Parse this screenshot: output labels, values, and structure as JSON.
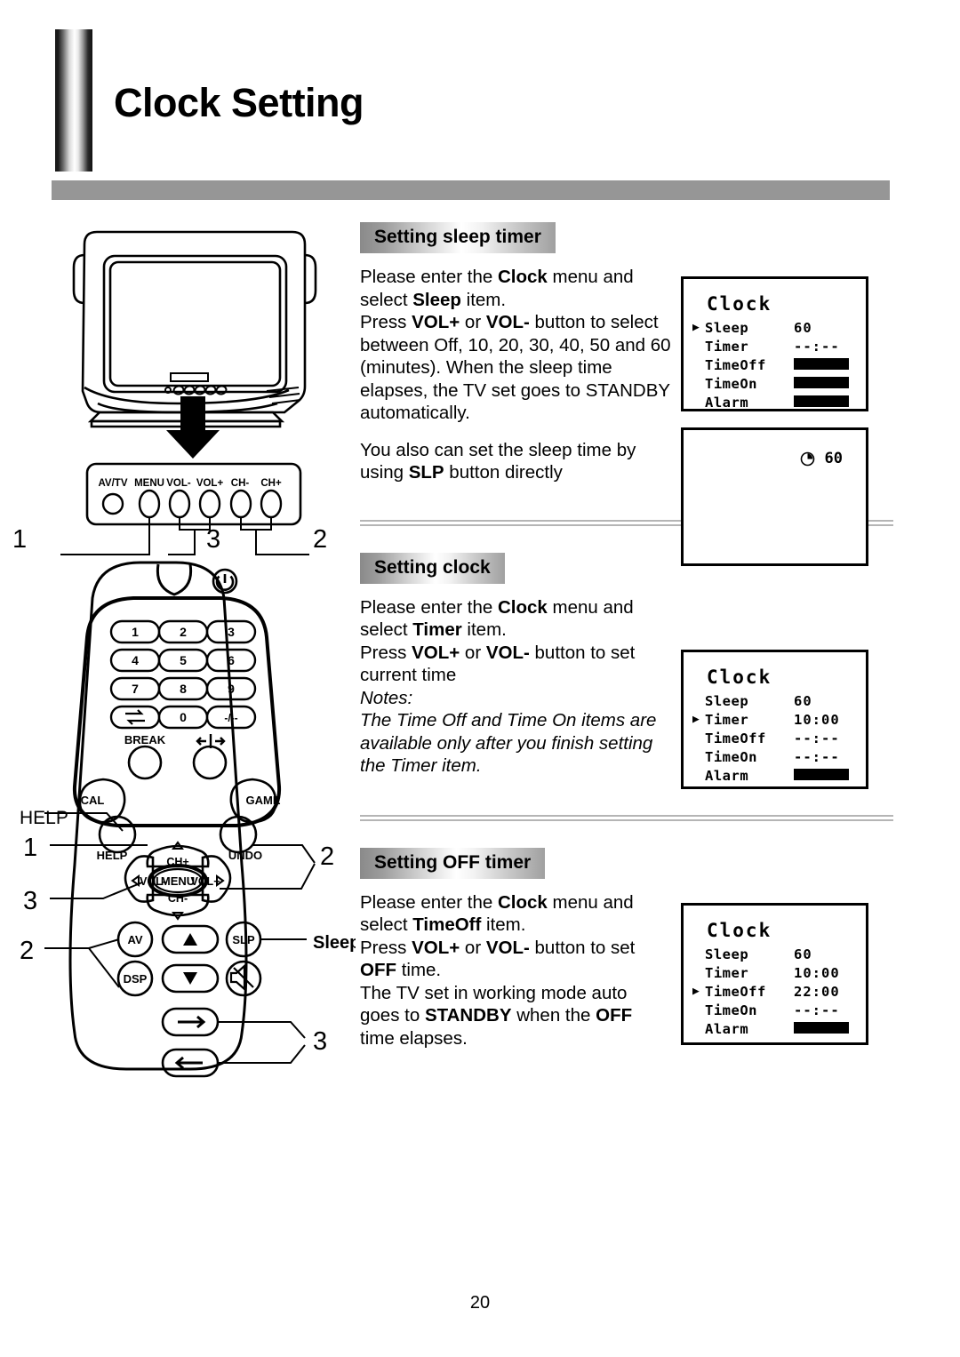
{
  "page": {
    "title": "Clock Setting",
    "number": "20"
  },
  "illustration": {
    "tv": {
      "panel_buttons": [
        "AV/TV",
        "MENU",
        "VOL-",
        "VOL+",
        "CH-",
        "CH+"
      ],
      "callouts": [
        "1",
        "3",
        "2"
      ]
    },
    "remote": {
      "keypad": [
        "1",
        "2",
        "3",
        "4",
        "5",
        "6",
        "7",
        "8",
        "9",
        "0"
      ],
      "swap_key": "swap-icon",
      "minus_key": "-/--",
      "break_label": "BREAK",
      "freeze_label": "freeze-icon",
      "cal_label": "CAL",
      "game_label": "GAME",
      "help_label": "HELP",
      "undo_label": "UNDO",
      "menu_label": "MENU",
      "ch_up_label": "CH+",
      "ch_down_label": "CH-",
      "vol_down_label": "VOL-",
      "vol_up_label": "VOL+",
      "av_label": "AV",
      "dsp_label": "DSP",
      "slp_label": "SLP",
      "mute_label": "mute-icon",
      "help_callout": "HELP",
      "sleep_callout": "Sleep",
      "callouts": {
        "c1": "1",
        "c3a": "3",
        "c2a": "2",
        "c2b": "2",
        "c3b": "3"
      }
    }
  },
  "sections": [
    {
      "id": "sleep-timer",
      "heading": "Setting sleep timer",
      "paragraphs": [
        "Please enter the <b>Clock</b> menu and select <b>Sleep</b> item.<br>Press <b>VOL+</b> or <b>VOL-</b> button to select between Off, 10, 20, 30, 40, 50 and 60 (minutes). When the sleep time elapses, the TV set goes to STANDBY automatically.",
        "You also can set the sleep time by using <b>SLP</b> button directly"
      ]
    },
    {
      "id": "setting-clock",
      "heading": "Setting clock",
      "paragraphs": [
        "Please enter the <b>Clock</b> menu and select <b>Timer</b> item.<br>Press <b>VOL+</b> or <b>VOL-</b> button to set current time<br><i>Notes:</i><br><i>The Time Off and Time On items are available only after you finish setting the Timer item.</i>"
      ]
    },
    {
      "id": "off-timer",
      "heading": "Setting OFF timer",
      "paragraphs": [
        "Please enter the <b>Clock</b> menu and select <b>TimeOff</b> item.<br>Press <b>VOL+</b> or <b>VOL-</b> button to set <b>OFF</b> time.<br>The TV set in working mode auto goes to <b>STANDBY</b> when the <b>OFF</b> time elapses."
      ]
    }
  ],
  "osd_screens": [
    {
      "id": "osd-sleep",
      "title": "Clock",
      "rows": [
        {
          "caret": "▶",
          "label": "Sleep",
          "value": "60",
          "bar": false
        },
        {
          "caret": "",
          "label": "Timer",
          "value": "--:--",
          "bar": false
        },
        {
          "caret": "",
          "label": "TimeOff",
          "value": "",
          "bar": true
        },
        {
          "caret": "",
          "label": "TimeOn",
          "value": "",
          "bar": true
        },
        {
          "caret": "",
          "label": "Alarm",
          "value": "",
          "bar": true
        }
      ]
    },
    {
      "id": "osd-slp-overlay",
      "clock_icon": "clock-icon",
      "clock_value": "60"
    },
    {
      "id": "osd-timer",
      "title": "Clock",
      "rows": [
        {
          "caret": "",
          "label": "Sleep",
          "value": "60",
          "bar": false
        },
        {
          "caret": "▶",
          "label": "Timer",
          "value": "10:00",
          "bar": false
        },
        {
          "caret": "",
          "label": "TimeOff",
          "value": "--:--",
          "bar": false
        },
        {
          "caret": "",
          "label": "TimeOn",
          "value": "--:--",
          "bar": false
        },
        {
          "caret": "",
          "label": "Alarm",
          "value": "",
          "bar": true
        }
      ]
    },
    {
      "id": "osd-timeoff",
      "title": "Clock",
      "rows": [
        {
          "caret": "",
          "label": "Sleep",
          "value": "60",
          "bar": false
        },
        {
          "caret": "",
          "label": "Timer",
          "value": "10:00",
          "bar": false
        },
        {
          "caret": "▶",
          "label": "TimeOff",
          "value": "22:00",
          "bar": false
        },
        {
          "caret": "",
          "label": "TimeOn",
          "value": "--:--",
          "bar": false
        },
        {
          "caret": "",
          "label": "Alarm",
          "value": "",
          "bar": true
        }
      ]
    }
  ],
  "colors": {
    "header_bar": "#969696",
    "heading_gradient_dark": "#8a8a8a",
    "divider": "#b5b5b5"
  }
}
